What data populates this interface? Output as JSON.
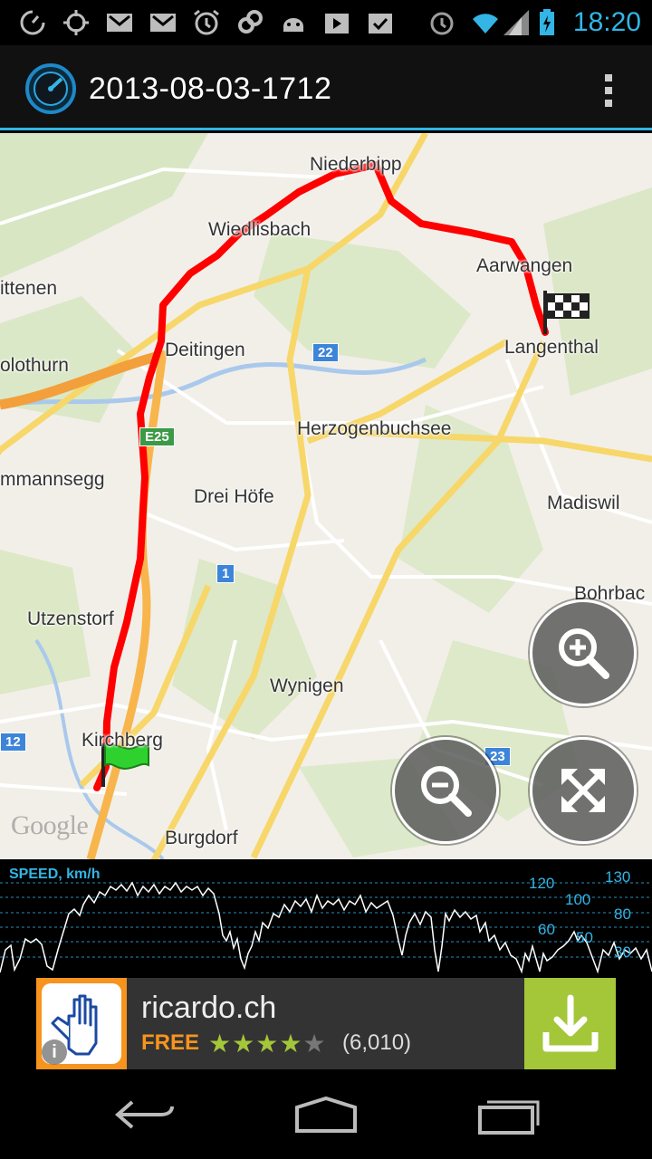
{
  "status_bar": {
    "time": "18:20",
    "icons": [
      "sync-icon",
      "gps-icon",
      "gmail-icon",
      "gmail-icon",
      "alarm-icon",
      "link-icon",
      "android-icon",
      "play-store-icon",
      "task-icon",
      "alarm-icon",
      "wifi-icon",
      "signal-icon",
      "battery-charging-icon"
    ]
  },
  "action_bar": {
    "title": "2013-08-03-1712",
    "app_icon": "speedometer-icon",
    "overflow_icon": "overflow-menu-icon"
  },
  "map": {
    "places": [
      "Niederbipp",
      "Wiedlisbach",
      "Aarwangen",
      "ittenen",
      "Langenthal",
      "olothurn",
      "Deitingen",
      "Herzogenbuchsee",
      "mmannsegg",
      "Drei Höfe",
      "Madiswil",
      "Bohrbac",
      "Utzenstorf",
      "Wynigen",
      "Kirchberg",
      "Burgdorf"
    ],
    "shields": [
      "22",
      "E25",
      "1",
      "12",
      "23"
    ],
    "attribution": "Google",
    "start_marker": "start-flag-icon",
    "finish_marker": "finish-flag-icon",
    "buttons": {
      "zoom_in": "zoom-in-icon",
      "zoom_out": "zoom-out-icon",
      "fit": "fullscreen-icon"
    }
  },
  "speed_graph": {
    "label": "SPEED, km/h",
    "left_axis": [
      "120",
      "100",
      "60",
      "50"
    ],
    "right_axis": [
      "130",
      "80",
      "30"
    ]
  },
  "ad": {
    "title": "ricardo.ch",
    "price": "FREE",
    "rating": 4,
    "rating_max": 5,
    "reviews": "(6,010)",
    "info": "i"
  },
  "nav": {
    "back": "back-icon",
    "home": "home-icon",
    "recents": "recents-icon"
  },
  "colors": {
    "accent": "#33b5e5",
    "track": "#ff0000",
    "ad_accent": "#f7941d",
    "download": "#a4c639"
  }
}
